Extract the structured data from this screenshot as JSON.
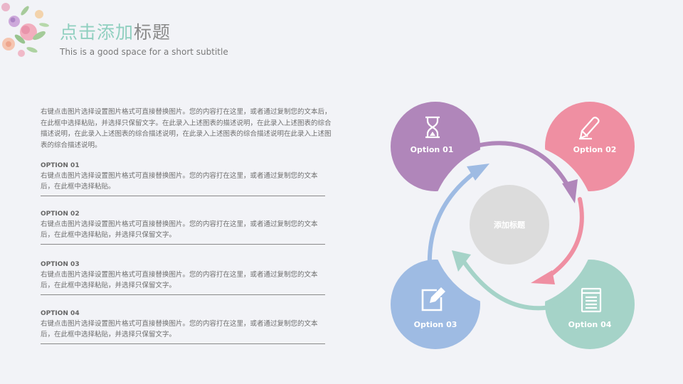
{
  "header": {
    "title_highlight": "点击添加",
    "title_rest": "标题",
    "subtitle": "This is a good space for a short subtitle"
  },
  "intro": "右键点击图片选择设置图片格式可直接替换图片。您的内容打在这里，或者通过复制您的文本后，在此框中选择粘贴，并选择只保留文字。在此录入上述图表的描述说明，在此录入上述图表的综合描述说明，在此录入上述图表的综合描述说明，在此录入上述图表的综合描述说明在此录入上述图表的综合描述说明。",
  "options": [
    {
      "title": "OPTION 01",
      "text": "右键点击图片选择设置图片格式可直接替换图片。您的内容打在这里，或者通过复制您的文本后，在此框中选择粘贴。"
    },
    {
      "title": "OPTION 02",
      "text": "右键点击图片选择设置图片格式可直接替换图片。您的内容打在这里，或者通过复制您的文本后，在此框中选择粘贴，并选择只保留文字。"
    },
    {
      "title": "OPTION 03",
      "text": "右键点击图片选择设置图片格式可直接替换图片。您的内容打在这里，或者通过复制您的文本后，在此框中选择粘贴，并选择只保留文字。"
    },
    {
      "title": "OPTION 04",
      "text": "右键点击图片选择设置图片格式可直接替换图片。您的内容打在这里，或者通过复制您的文本后，在此框中选择粘贴，并选择只保留文字。"
    }
  ],
  "diagram": {
    "center_label": "添加标题",
    "nodes": [
      {
        "label": "Option 01",
        "color": "#b086ba",
        "icon": "hourglass-icon"
      },
      {
        "label": "Option 02",
        "color": "#ef8fa2",
        "icon": "pencil-icon"
      },
      {
        "label": "Option 03",
        "color": "#9ebbe3",
        "icon": "edit-icon"
      },
      {
        "label": "Option 04",
        "color": "#a5d3c8",
        "icon": "notepad-icon"
      }
    ],
    "center_color": "#dcdcdc"
  }
}
